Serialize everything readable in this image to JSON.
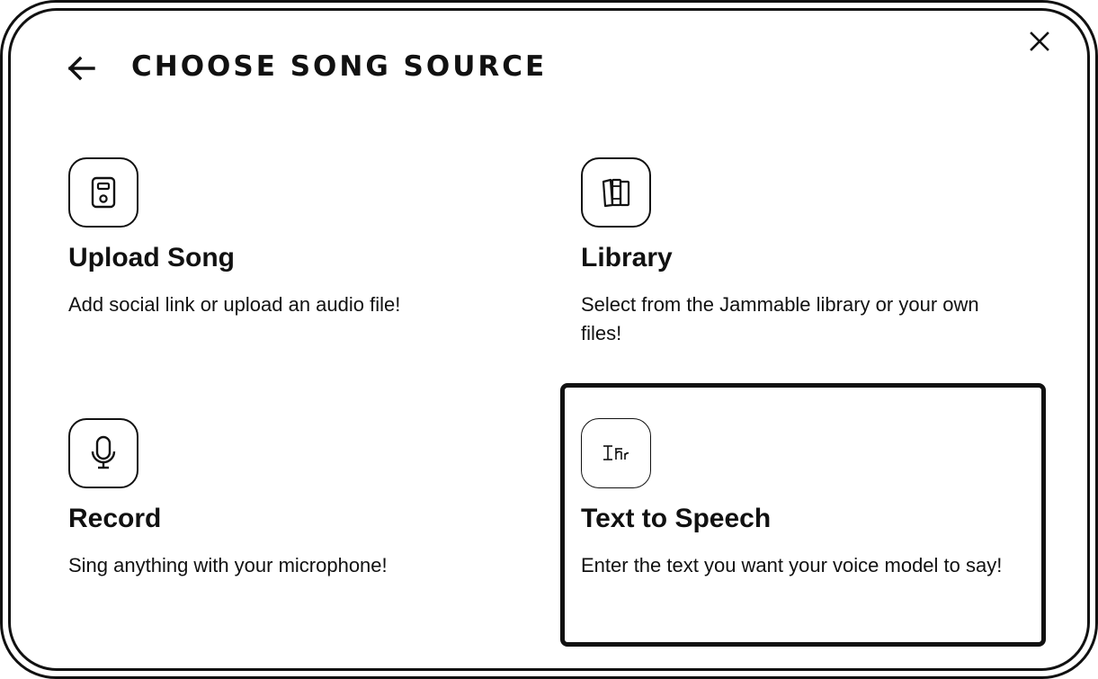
{
  "dialog": {
    "title": "CHOOSE SONG SOURCE"
  },
  "options": [
    {
      "title": "Upload Song",
      "description": "Add social link or upload an audio file!",
      "icon": "audio-device-icon",
      "selected": false
    },
    {
      "title": "Library",
      "description": "Select from the Jammable library or your own files!",
      "icon": "library-books-icon",
      "selected": false
    },
    {
      "title": "Record",
      "description": "Sing anything with your microphone!",
      "icon": "microphone-icon",
      "selected": false
    },
    {
      "title": "Text to Speech",
      "description": "Enter the text you want your voice model to say!",
      "icon": "text-icon",
      "selected": true
    }
  ]
}
